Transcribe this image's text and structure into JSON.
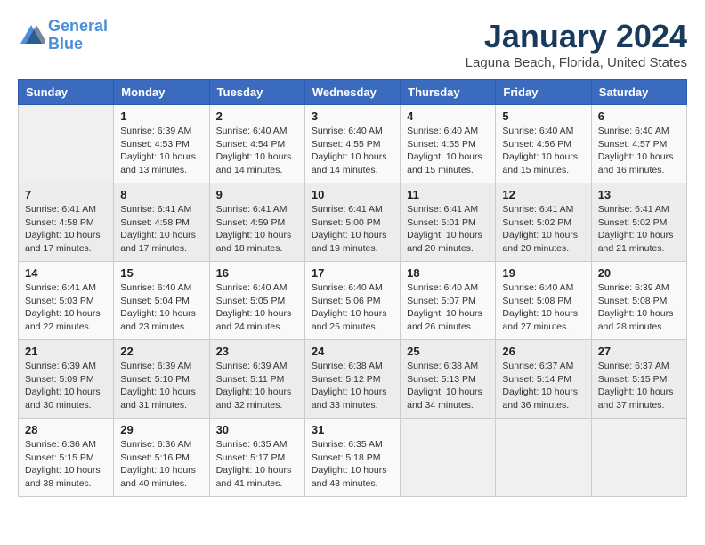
{
  "header": {
    "logo_line1": "General",
    "logo_line2": "Blue",
    "main_title": "January 2024",
    "subtitle": "Laguna Beach, Florida, United States"
  },
  "days_of_week": [
    "Sunday",
    "Monday",
    "Tuesday",
    "Wednesday",
    "Thursday",
    "Friday",
    "Saturday"
  ],
  "weeks": [
    [
      {
        "day": "",
        "info": ""
      },
      {
        "day": "1",
        "info": "Sunrise: 6:39 AM\nSunset: 4:53 PM\nDaylight: 10 hours\nand 13 minutes."
      },
      {
        "day": "2",
        "info": "Sunrise: 6:40 AM\nSunset: 4:54 PM\nDaylight: 10 hours\nand 14 minutes."
      },
      {
        "day": "3",
        "info": "Sunrise: 6:40 AM\nSunset: 4:55 PM\nDaylight: 10 hours\nand 14 minutes."
      },
      {
        "day": "4",
        "info": "Sunrise: 6:40 AM\nSunset: 4:55 PM\nDaylight: 10 hours\nand 15 minutes."
      },
      {
        "day": "5",
        "info": "Sunrise: 6:40 AM\nSunset: 4:56 PM\nDaylight: 10 hours\nand 15 minutes."
      },
      {
        "day": "6",
        "info": "Sunrise: 6:40 AM\nSunset: 4:57 PM\nDaylight: 10 hours\nand 16 minutes."
      }
    ],
    [
      {
        "day": "7",
        "info": "Sunrise: 6:41 AM\nSunset: 4:58 PM\nDaylight: 10 hours\nand 17 minutes."
      },
      {
        "day": "8",
        "info": "Sunrise: 6:41 AM\nSunset: 4:58 PM\nDaylight: 10 hours\nand 17 minutes."
      },
      {
        "day": "9",
        "info": "Sunrise: 6:41 AM\nSunset: 4:59 PM\nDaylight: 10 hours\nand 18 minutes."
      },
      {
        "day": "10",
        "info": "Sunrise: 6:41 AM\nSunset: 5:00 PM\nDaylight: 10 hours\nand 19 minutes."
      },
      {
        "day": "11",
        "info": "Sunrise: 6:41 AM\nSunset: 5:01 PM\nDaylight: 10 hours\nand 20 minutes."
      },
      {
        "day": "12",
        "info": "Sunrise: 6:41 AM\nSunset: 5:02 PM\nDaylight: 10 hours\nand 20 minutes."
      },
      {
        "day": "13",
        "info": "Sunrise: 6:41 AM\nSunset: 5:02 PM\nDaylight: 10 hours\nand 21 minutes."
      }
    ],
    [
      {
        "day": "14",
        "info": "Sunrise: 6:41 AM\nSunset: 5:03 PM\nDaylight: 10 hours\nand 22 minutes."
      },
      {
        "day": "15",
        "info": "Sunrise: 6:40 AM\nSunset: 5:04 PM\nDaylight: 10 hours\nand 23 minutes."
      },
      {
        "day": "16",
        "info": "Sunrise: 6:40 AM\nSunset: 5:05 PM\nDaylight: 10 hours\nand 24 minutes."
      },
      {
        "day": "17",
        "info": "Sunrise: 6:40 AM\nSunset: 5:06 PM\nDaylight: 10 hours\nand 25 minutes."
      },
      {
        "day": "18",
        "info": "Sunrise: 6:40 AM\nSunset: 5:07 PM\nDaylight: 10 hours\nand 26 minutes."
      },
      {
        "day": "19",
        "info": "Sunrise: 6:40 AM\nSunset: 5:08 PM\nDaylight: 10 hours\nand 27 minutes."
      },
      {
        "day": "20",
        "info": "Sunrise: 6:39 AM\nSunset: 5:08 PM\nDaylight: 10 hours\nand 28 minutes."
      }
    ],
    [
      {
        "day": "21",
        "info": "Sunrise: 6:39 AM\nSunset: 5:09 PM\nDaylight: 10 hours\nand 30 minutes."
      },
      {
        "day": "22",
        "info": "Sunrise: 6:39 AM\nSunset: 5:10 PM\nDaylight: 10 hours\nand 31 minutes."
      },
      {
        "day": "23",
        "info": "Sunrise: 6:39 AM\nSunset: 5:11 PM\nDaylight: 10 hours\nand 32 minutes."
      },
      {
        "day": "24",
        "info": "Sunrise: 6:38 AM\nSunset: 5:12 PM\nDaylight: 10 hours\nand 33 minutes."
      },
      {
        "day": "25",
        "info": "Sunrise: 6:38 AM\nSunset: 5:13 PM\nDaylight: 10 hours\nand 34 minutes."
      },
      {
        "day": "26",
        "info": "Sunrise: 6:37 AM\nSunset: 5:14 PM\nDaylight: 10 hours\nand 36 minutes."
      },
      {
        "day": "27",
        "info": "Sunrise: 6:37 AM\nSunset: 5:15 PM\nDaylight: 10 hours\nand 37 minutes."
      }
    ],
    [
      {
        "day": "28",
        "info": "Sunrise: 6:36 AM\nSunset: 5:15 PM\nDaylight: 10 hours\nand 38 minutes."
      },
      {
        "day": "29",
        "info": "Sunrise: 6:36 AM\nSunset: 5:16 PM\nDaylight: 10 hours\nand 40 minutes."
      },
      {
        "day": "30",
        "info": "Sunrise: 6:35 AM\nSunset: 5:17 PM\nDaylight: 10 hours\nand 41 minutes."
      },
      {
        "day": "31",
        "info": "Sunrise: 6:35 AM\nSunset: 5:18 PM\nDaylight: 10 hours\nand 43 minutes."
      },
      {
        "day": "",
        "info": ""
      },
      {
        "day": "",
        "info": ""
      },
      {
        "day": "",
        "info": ""
      }
    ]
  ]
}
